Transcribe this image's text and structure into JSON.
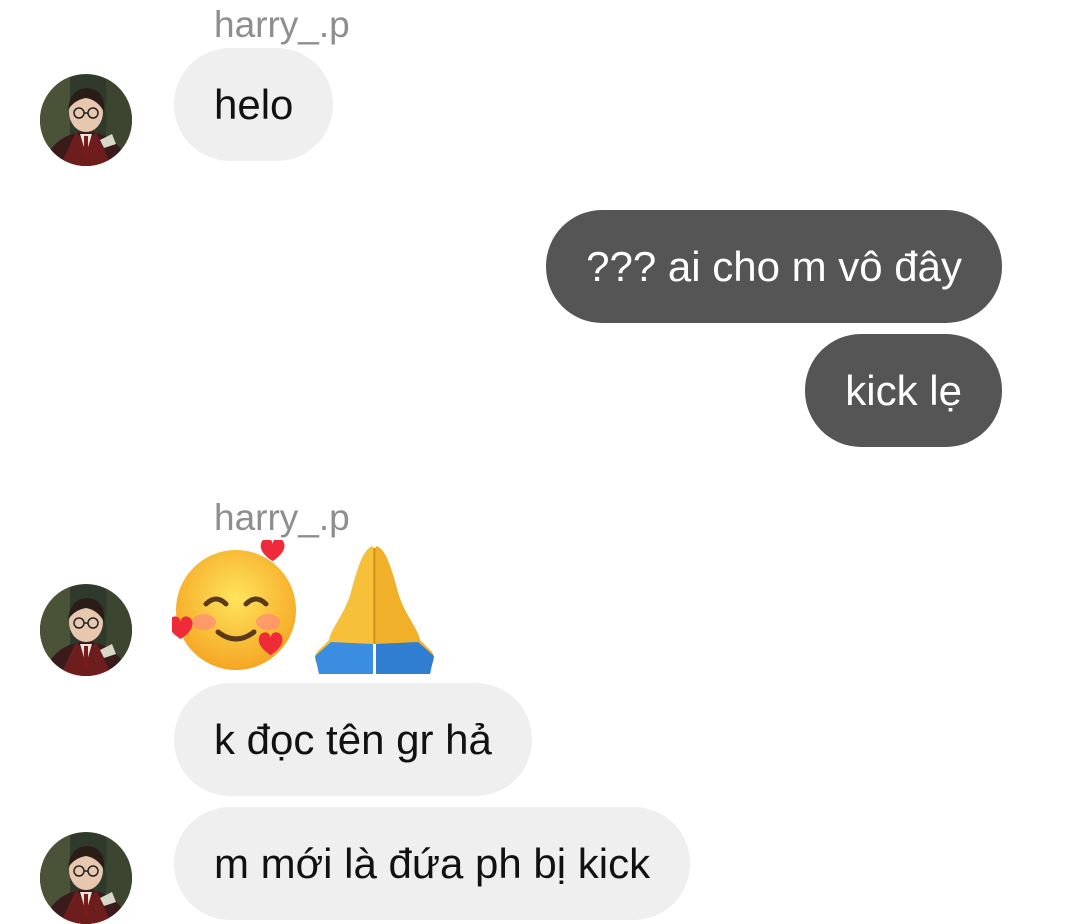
{
  "conversation": {
    "messages": [
      {
        "sender": "harry_.p",
        "text": "helo"
      },
      {
        "sender": "me",
        "text": "??? ai cho m vô đây"
      },
      {
        "sender": "me",
        "text": "kick lẹ"
      },
      {
        "sender": "harry_.p",
        "emoji": [
          "smiling-face-with-hearts",
          "folded-hands"
        ]
      },
      {
        "sender": "harry_.p",
        "text": "k đọc tên gr hả"
      },
      {
        "sender": "harry_.p",
        "text": "m mới là đứa ph bị kick"
      }
    ]
  },
  "colors": {
    "incoming_bubble": "#efefef",
    "outgoing_bubble": "#555555",
    "sender_name": "#8e8e8e"
  }
}
